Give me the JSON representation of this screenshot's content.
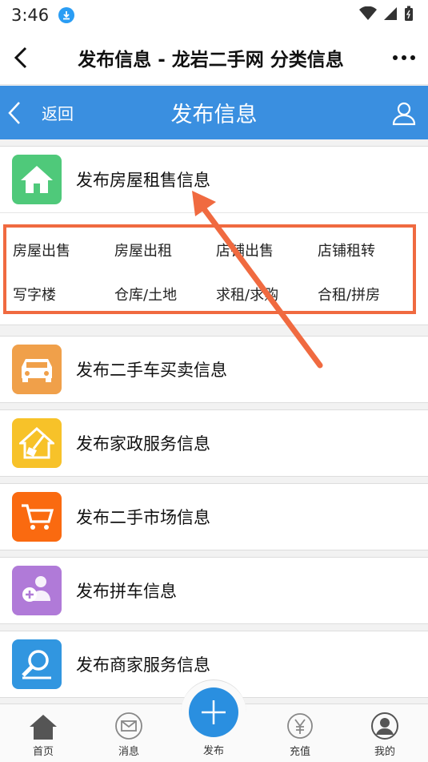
{
  "status": {
    "time": "3:46"
  },
  "titlebar": {
    "title": "发布信息 - 龙岩二手网 分类信息"
  },
  "bluebar": {
    "back_label": "返回",
    "title": "发布信息"
  },
  "categories": [
    {
      "label": "发布房屋租售信息",
      "icon": "house-icon",
      "color": "#4fc97a"
    },
    {
      "label": "发布二手车买卖信息",
      "icon": "car-icon",
      "color": "#f0a04a"
    },
    {
      "label": "发布家政服务信息",
      "icon": "broom-house-icon",
      "color": "#f7c229"
    },
    {
      "label": "发布二手市场信息",
      "icon": "cart-icon",
      "color": "#fa6a10"
    },
    {
      "label": "发布拼车信息",
      "icon": "carpool-icon",
      "color": "#b07ad8"
    },
    {
      "label": "发布商家服务信息",
      "icon": "magnifier-icon",
      "color": "#3196e0"
    }
  ],
  "house_sub": [
    "房屋出售",
    "房屋出租",
    "店铺出售",
    "店铺租转",
    "写字楼",
    "仓库/土地",
    "求租/求购",
    "合租/拼房"
  ],
  "tabbar": {
    "home": "首页",
    "messages": "消息",
    "publish": "发布",
    "recharge": "充值",
    "mine": "我的"
  }
}
